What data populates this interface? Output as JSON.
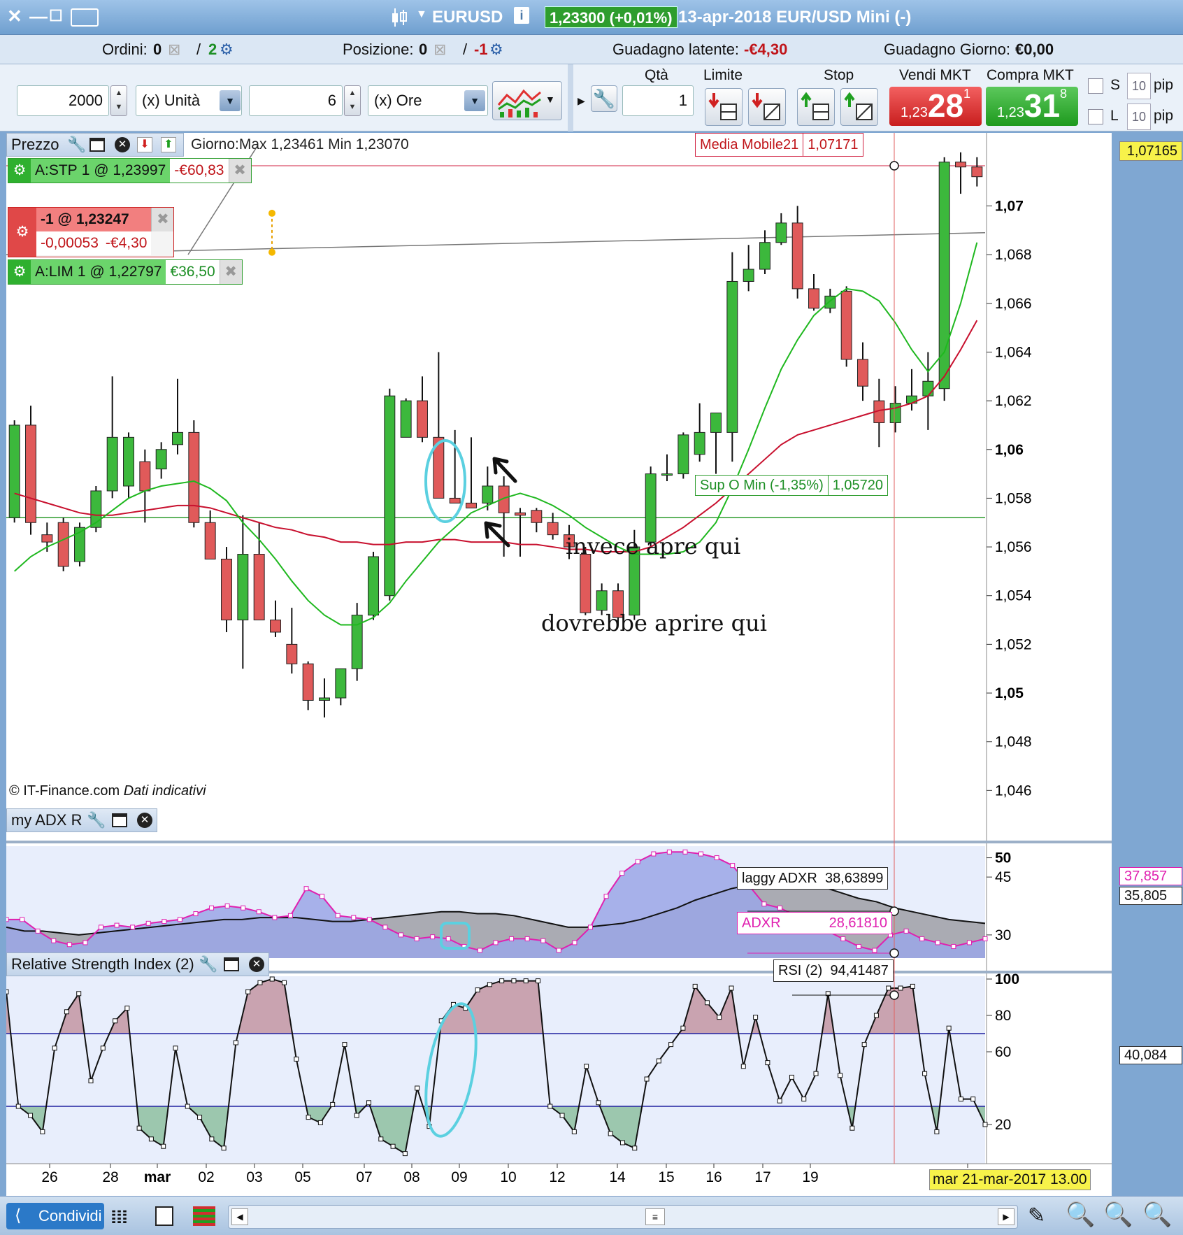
{
  "window": {
    "symbol": "EURUSD",
    "price_badge": "1,23300 (+0,01%)",
    "title": "13-apr-2018 EUR/USD Mini (-)"
  },
  "infobar": {
    "orders_label": "Ordini:",
    "orders_value": "0",
    "orders_sep": "/",
    "orders_active": "2",
    "position_label": "Posizione:",
    "position_value": "0",
    "position_sep": "/",
    "position_active": "-1",
    "unrealized_label": "Guadagno latente:",
    "unrealized_value": "-€4,30",
    "daily_label": "Guadagno Giorno:",
    "daily_value": "€0,00"
  },
  "toolbar": {
    "units_value": "2000",
    "units_combo": "(x) Unità",
    "period_value": "6",
    "period_combo": "(x) Ore",
    "qty_label": "Qtà",
    "qty_value": "1",
    "limit_label": "Limite",
    "stop_label": "Stop",
    "sell_label": "Vendi MKT",
    "buy_label": "Compra MKT",
    "sell_prefix": "1,23",
    "sell_big": "28",
    "sell_sup": "1",
    "buy_prefix": "1,23",
    "buy_big": "31",
    "buy_sup": "8",
    "s_label": "S",
    "l_label": "L",
    "s_pips": "10",
    "l_pips": "10",
    "pip_label": "pip"
  },
  "price_panel": {
    "title": "Prezzo",
    "range_info": "Giorno:Max 1,23461 Min 1,23070",
    "copyright": "© IT-Finance.com",
    "disclaimer": "Dati indicativi",
    "ma_label": "Media Mobile21",
    "ma_value": "1,07171",
    "ma_axis_value": "1,07165",
    "sup_label": "Sup O Min (-1,35%)",
    "sup_value": "1,05720",
    "orders": [
      {
        "name": "A:STP",
        "qty": "1 @ 1,23997",
        "pnl": "-€60,83"
      },
      {
        "name": "-1 @ 1,23247",
        "qty": "-0,00053",
        "pnl": "-€4,30"
      },
      {
        "name": "A:LIM",
        "qty": "1 @ 1,22797",
        "pnl": "€36,50"
      }
    ],
    "y_ticks": [
      "1,07",
      "1,068",
      "1,066",
      "1,064",
      "1,062",
      "1,06",
      "1,058",
      "1,056",
      "1,054",
      "1,052",
      "1,05",
      "1,048",
      "1,046"
    ],
    "annotations": [
      "invece apre qui",
      "dovrebbe aprire qui"
    ]
  },
  "adx_panel": {
    "title": "my ADX R",
    "laggy_label": "laggy ADXR",
    "laggy_value": "38,63899",
    "adxr_label": "ADXR",
    "adxr_value": "28,61810",
    "y_ticks": [
      "50",
      "45",
      "30"
    ],
    "tag_red": "37,857",
    "tag_dark": "35,805"
  },
  "rsi_panel": {
    "title": "Relative Strength Index (2)",
    "rsi_label": "RSI (2)",
    "rsi_value": "94,41487",
    "y_ticks": [
      "100",
      "80",
      "60",
      "20"
    ],
    "tag": "40,084"
  },
  "x_axis": {
    "labels": [
      "26",
      "28",
      "mar",
      "02",
      "03",
      "05",
      "07",
      "08",
      "09",
      "10",
      "12",
      "14",
      "15",
      "16",
      "17",
      "19",
      "3"
    ],
    "cursor_label": "mar 21-mar-2017 13.00"
  },
  "bottombar": {
    "share_label": "Condividi"
  },
  "colors": {
    "up": "#3cb83c",
    "down": "#e05a5a",
    "ma_fast": "#1fb81f",
    "ma_slow": "#c8102e",
    "adxr_line": "#e020b0",
    "highlight": "#5bd0e0"
  },
  "chart_data": [
    {
      "type": "candlestick",
      "title": "EURUSD",
      "ylim": [
        1.044,
        1.073
      ],
      "bars": [
        {
          "o": 1.0572,
          "h": 1.0612,
          "l": 1.057,
          "c": 1.061
        },
        {
          "o": 1.061,
          "h": 1.0618,
          "l": 1.0565,
          "c": 1.057
        },
        {
          "o": 1.0565,
          "h": 1.057,
          "l": 1.0558,
          "c": 1.0562
        },
        {
          "o": 1.057,
          "h": 1.0572,
          "l": 1.055,
          "c": 1.0552
        },
        {
          "o": 1.0554,
          "h": 1.057,
          "l": 1.0552,
          "c": 1.0568
        },
        {
          "o": 1.0568,
          "h": 1.0585,
          "l": 1.0566,
          "c": 1.0583
        },
        {
          "o": 1.0583,
          "h": 1.063,
          "l": 1.058,
          "c": 1.0605
        },
        {
          "o": 1.0585,
          "h": 1.0607,
          "l": 1.058,
          "c": 1.0605
        },
        {
          "o": 1.0595,
          "h": 1.06,
          "l": 1.057,
          "c": 1.0583
        },
        {
          "o": 1.0592,
          "h": 1.0603,
          "l": 1.0588,
          "c": 1.06
        },
        {
          "o": 1.0602,
          "h": 1.0629,
          "l": 1.0598,
          "c": 1.0607
        },
        {
          "o": 1.0607,
          "h": 1.0612,
          "l": 1.0568,
          "c": 1.057
        },
        {
          "o": 1.057,
          "h": 1.0575,
          "l": 1.0555,
          "c": 1.0555
        },
        {
          "o": 1.0555,
          "h": 1.056,
          "l": 1.0525,
          "c": 1.053
        },
        {
          "o": 1.053,
          "h": 1.0573,
          "l": 1.051,
          "c": 1.0557
        },
        {
          "o": 1.0557,
          "h": 1.057,
          "l": 1.053,
          "c": 1.053
        },
        {
          "o": 1.053,
          "h": 1.0538,
          "l": 1.0523,
          "c": 1.0525
        },
        {
          "o": 1.052,
          "h": 1.0535,
          "l": 1.0508,
          "c": 1.0512
        },
        {
          "o": 1.0512,
          "h": 1.0513,
          "l": 1.0493,
          "c": 1.0497
        },
        {
          "o": 1.0497,
          "h": 1.0506,
          "l": 1.049,
          "c": 1.0498
        },
        {
          "o": 1.0498,
          "h": 1.051,
          "l": 1.0495,
          "c": 1.051
        },
        {
          "o": 1.051,
          "h": 1.0537,
          "l": 1.0505,
          "c": 1.0532
        },
        {
          "o": 1.0532,
          "h": 1.0558,
          "l": 1.053,
          "c": 1.0556
        },
        {
          "o": 1.054,
          "h": 1.0625,
          "l": 1.0538,
          "c": 1.0622
        },
        {
          "o": 1.0605,
          "h": 1.0621,
          "l": 1.0605,
          "c": 1.062
        },
        {
          "o": 1.062,
          "h": 1.063,
          "l": 1.0603,
          "c": 1.0605
        },
        {
          "o": 1.0605,
          "h": 1.064,
          "l": 1.058,
          "c": 1.058
        },
        {
          "o": 1.058,
          "h": 1.0608,
          "l": 1.0578,
          "c": 1.0578
        },
        {
          "o": 1.0578,
          "h": 1.0605,
          "l": 1.0576,
          "c": 1.0576
        },
        {
          "o": 1.0578,
          "h": 1.0593,
          "l": 1.0575,
          "c": 1.0585
        },
        {
          "o": 1.0585,
          "h": 1.0589,
          "l": 1.0556,
          "c": 1.0574
        },
        {
          "o": 1.0574,
          "h": 1.0576,
          "l": 1.0556,
          "c": 1.0573
        },
        {
          "o": 1.0575,
          "h": 1.0576,
          "l": 1.0566,
          "c": 1.057
        },
        {
          "o": 1.057,
          "h": 1.0574,
          "l": 1.0563,
          "c": 1.0565
        },
        {
          "o": 1.0565,
          "h": 1.0569,
          "l": 1.0555,
          "c": 1.056
        },
        {
          "o": 1.0557,
          "h": 1.056,
          "l": 1.0532,
          "c": 1.0533
        },
        {
          "o": 1.0534,
          "h": 1.0545,
          "l": 1.0532,
          "c": 1.0542
        },
        {
          "o": 1.0542,
          "h": 1.0545,
          "l": 1.0528,
          "c": 1.0531
        },
        {
          "o": 1.0532,
          "h": 1.0567,
          "l": 1.053,
          "c": 1.056
        },
        {
          "o": 1.0562,
          "h": 1.0593,
          "l": 1.056,
          "c": 1.059
        },
        {
          "o": 1.059,
          "h": 1.0598,
          "l": 1.0587,
          "c": 1.059
        },
        {
          "o": 1.059,
          "h": 1.0607,
          "l": 1.0588,
          "c": 1.0606
        },
        {
          "o": 1.0598,
          "h": 1.0619,
          "l": 1.0595,
          "c": 1.0607
        },
        {
          "o": 1.0607,
          "h": 1.061,
          "l": 1.059,
          "c": 1.0615
        },
        {
          "o": 1.0607,
          "h": 1.0681,
          "l": 1.0595,
          "c": 1.0669
        },
        {
          "o": 1.0669,
          "h": 1.0684,
          "l": 1.0665,
          "c": 1.0674
        },
        {
          "o": 1.0674,
          "h": 1.069,
          "l": 1.0672,
          "c": 1.0685
        },
        {
          "o": 1.0685,
          "h": 1.0697,
          "l": 1.0684,
          "c": 1.0693
        },
        {
          "o": 1.0693,
          "h": 1.07,
          "l": 1.0662,
          "c": 1.0666
        },
        {
          "o": 1.0666,
          "h": 1.0672,
          "l": 1.0657,
          "c": 1.0658
        },
        {
          "o": 1.0658,
          "h": 1.0666,
          "l": 1.0656,
          "c": 1.0663
        },
        {
          "o": 1.0665,
          "h": 1.0667,
          "l": 1.0634,
          "c": 1.0637
        },
        {
          "o": 1.0637,
          "h": 1.0644,
          "l": 1.062,
          "c": 1.0626
        },
        {
          "o": 1.062,
          "h": 1.0629,
          "l": 1.0601,
          "c": 1.0611
        },
        {
          "o": 1.0611,
          "h": 1.0626,
          "l": 1.0607,
          "c": 1.0619
        },
        {
          "o": 1.0619,
          "h": 1.0633,
          "l": 1.0616,
          "c": 1.0622
        },
        {
          "o": 1.0622,
          "h": 1.064,
          "l": 1.0608,
          "c": 1.0628
        },
        {
          "o": 1.0625,
          "h": 1.072,
          "l": 1.062,
          "c": 1.0718
        },
        {
          "o": 1.0718,
          "h": 1.0722,
          "l": 1.0705,
          "c": 1.0716
        },
        {
          "o": 1.0716,
          "h": 1.072,
          "l": 1.0708,
          "c": 1.0712
        }
      ],
      "series": [
        {
          "name": "Media Mobile21",
          "values": [
            1.0582,
            1.058,
            1.0578,
            1.0576,
            1.0574,
            1.0573,
            1.0573,
            1.0574,
            1.0575,
            1.0576,
            1.0577,
            1.0577,
            1.0576,
            1.0574,
            1.0572,
            1.057,
            1.0568,
            1.0567,
            1.0565,
            1.0564,
            1.0562,
            1.0562,
            1.0561,
            1.0561,
            1.0562,
            1.0562,
            1.0563,
            1.0563,
            1.0562,
            1.0562,
            1.0562,
            1.0561,
            1.0561,
            1.056,
            1.0559,
            1.0559,
            1.0558,
            1.0558,
            1.0558,
            1.056,
            1.0564,
            1.0568,
            1.0573,
            1.0578,
            1.0584,
            1.059,
            1.0596,
            1.0602,
            1.0606,
            1.0608,
            1.061,
            1.0612,
            1.0614,
            1.0616,
            1.0617,
            1.0619,
            1.0622,
            1.063,
            1.0641,
            1.0653
          ]
        },
        {
          "name": "",
          "values": [
            1.055,
            1.0556,
            1.056,
            1.0563,
            1.0566,
            1.057,
            1.0575,
            1.058,
            1.0583,
            1.0585,
            1.0586,
            1.0587,
            1.0584,
            1.0579,
            1.057,
            1.0563,
            1.0555,
            1.0546,
            1.0538,
            1.0532,
            1.0528,
            1.0528,
            1.0531,
            1.0537,
            1.0546,
            1.0554,
            1.0562,
            1.0568,
            1.0574,
            1.0577,
            1.058,
            1.0582,
            1.058,
            1.0577,
            1.0573,
            1.0568,
            1.0564,
            1.056,
            1.0557,
            1.0557,
            1.0557,
            1.0558,
            1.0562,
            1.057,
            1.0584,
            1.06,
            1.0617,
            1.0633,
            1.0645,
            1.0655,
            1.0661,
            1.0666,
            1.0665,
            1.0661,
            1.0652,
            1.0641,
            1.0632,
            1.064,
            1.066,
            1.0685
          ]
        }
      ]
    },
    {
      "type": "area",
      "title": "my ADX R",
      "ylim": [
        24,
        53
      ],
      "series": [
        {
          "name": "laggy ADXR",
          "values": [
            32,
            31,
            31,
            30.5,
            30,
            30.5,
            31,
            31.5,
            32,
            32.5,
            33,
            33.5,
            34,
            34,
            34.5,
            34.5,
            34.5,
            34,
            33.5,
            33.5,
            34,
            34.5,
            35,
            35.5,
            36,
            36,
            35.5,
            35.5,
            35,
            34,
            33,
            32,
            32,
            32.5,
            33,
            34,
            35.5,
            37,
            39,
            40.5,
            42,
            43,
            43.5,
            43.8,
            43.5,
            42.5,
            41,
            39.5,
            38.6,
            37,
            36,
            35,
            34,
            33.5,
            33
          ]
        },
        {
          "name": "ADXR",
          "values": [
            34,
            34,
            31,
            28.5,
            27.5,
            28,
            32,
            32.5,
            32,
            33,
            33.5,
            34,
            35.5,
            37,
            37.5,
            37,
            36,
            34.5,
            35,
            42,
            40,
            35,
            34.5,
            34,
            32,
            30,
            29,
            29.5,
            29,
            27,
            26,
            28,
            29,
            29,
            28.5,
            26,
            28,
            32,
            40,
            46,
            49,
            51,
            51.5,
            51.5,
            51,
            50,
            48,
            43,
            38,
            37,
            35,
            34,
            31,
            29,
            27,
            26,
            30,
            31,
            29,
            28,
            27,
            28,
            29
          ]
        }
      ]
    },
    {
      "type": "line",
      "title": "Relative Strength Index (2)",
      "ylim": [
        0,
        100
      ],
      "series": [
        {
          "name": "RSI (2)",
          "values": [
            93,
            30,
            25,
            16,
            62,
            82,
            92,
            44,
            62,
            77,
            84,
            18,
            12,
            8,
            62,
            30,
            24,
            12,
            7,
            65,
            93,
            98,
            100,
            98,
            56,
            24,
            21,
            31,
            64,
            25,
            32,
            12,
            8,
            4,
            40,
            19,
            77,
            86,
            84,
            94,
            97,
            99,
            99,
            99,
            99,
            30,
            25,
            16,
            52,
            32,
            15,
            10,
            7,
            45,
            55,
            64,
            73,
            96,
            87,
            79,
            95,
            52,
            79,
            54,
            33,
            46,
            34,
            48,
            92,
            47,
            18,
            64,
            80,
            95,
            95,
            96,
            48,
            16,
            73,
            34,
            34,
            20
          ]
        }
      ]
    }
  ]
}
